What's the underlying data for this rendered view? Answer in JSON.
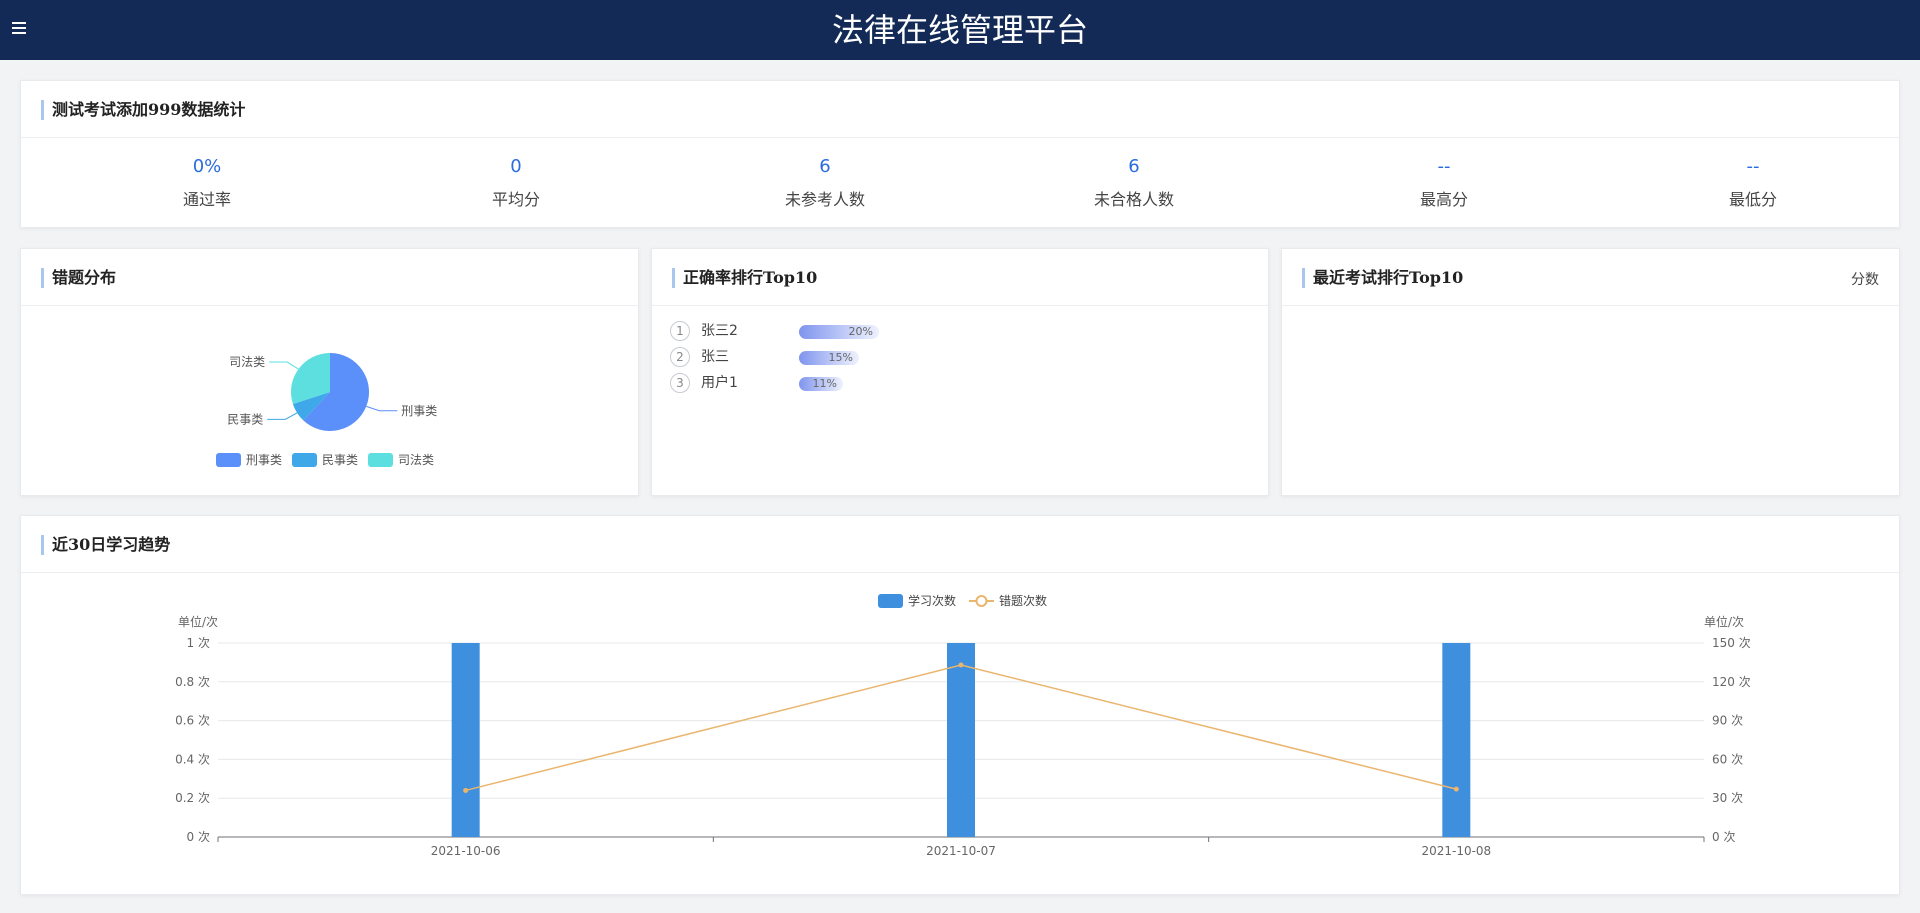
{
  "app": {
    "title": "法律在线管理平台",
    "menu_icon": "hamburger-icon"
  },
  "summary": {
    "title": "测试考试添加999数据统计",
    "stats": [
      {
        "value": "0%",
        "label": "通过率"
      },
      {
        "value": "0",
        "label": "平均分"
      },
      {
        "value": "6",
        "label": "未参考人数"
      },
      {
        "value": "6",
        "label": "未合格人数"
      },
      {
        "value": "--",
        "label": "最高分"
      },
      {
        "value": "--",
        "label": "最低分"
      }
    ]
  },
  "error_distribution": {
    "title": "错题分布",
    "chart_data": {
      "type": "pie",
      "categories": [
        "刑事类",
        "民事类",
        "司法类"
      ],
      "values": [
        62,
        8,
        30
      ],
      "colors": [
        "#5b8ff9",
        "#3ea8e8",
        "#5ddfe0"
      ],
      "legend": "bottom"
    }
  },
  "accuracy_rank": {
    "title": "正确率排行Top10",
    "items": [
      {
        "rank": "1",
        "name": "张三2",
        "percent": "20%",
        "fraction": 0.2
      },
      {
        "rank": "2",
        "name": "张三",
        "percent": "15%",
        "fraction": 0.15
      },
      {
        "rank": "3",
        "name": "用户1",
        "percent": "11%",
        "fraction": 0.11
      }
    ]
  },
  "recent_rank": {
    "title": "最近考试排行Top10",
    "extra": "分数"
  },
  "trend": {
    "title": "近30日学习趋势",
    "chart_data": {
      "type": "bar",
      "categories": [
        "2021-10-06",
        "2021-10-07",
        "2021-10-08"
      ],
      "series": [
        {
          "name": "学习次数",
          "type": "bar",
          "axis": "left",
          "values": [
            1,
            1,
            1
          ],
          "color": "#3e8fdd"
        },
        {
          "name": "错题次数",
          "type": "line",
          "axis": "right",
          "values": [
            36,
            133,
            37
          ],
          "color": "#eab56d"
        }
      ],
      "left_axis": {
        "label": "单位/次",
        "range": [
          0,
          1
        ],
        "ticks": [
          "0 次",
          "0.2 次",
          "0.4 次",
          "0.6 次",
          "0.8 次",
          "1 次"
        ]
      },
      "right_axis": {
        "label": "单位/次",
        "range": [
          0,
          150
        ],
        "ticks": [
          "0 次",
          "30 次",
          "60 次",
          "90 次",
          "120 次",
          "150 次"
        ]
      },
      "legend": "top",
      "grid": true
    }
  }
}
